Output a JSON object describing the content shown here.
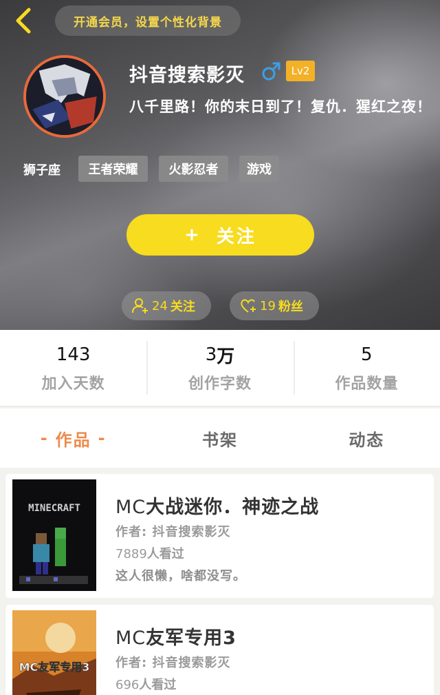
{
  "header": {
    "vip_banner": "开通会员，设置个性化背景",
    "username": "抖音搜索影灭",
    "level": "Lv2",
    "signature": "八千里路！你的末日到了！复仇．猩红之夜！",
    "zodiac": "狮子座",
    "tags": [
      "王者荣耀",
      "火影忍者",
      "游戏"
    ],
    "follow_button": {
      "plus": "+",
      "label": "关注"
    },
    "following": {
      "count": "24",
      "label": "关注"
    },
    "fans": {
      "count": "19",
      "label": "粉丝"
    }
  },
  "stats": [
    {
      "value": "143",
      "label": "加入天数"
    },
    {
      "value": "3",
      "unit": "万",
      "label": "创作字数"
    },
    {
      "value": "5",
      "label": "作品数量"
    }
  ],
  "tabs": {
    "active_dash": "-",
    "items": [
      "作品",
      "书架",
      "动态"
    ]
  },
  "works": [
    {
      "title_prefix": "MC",
      "title_rest": "大战迷你．神迹之战",
      "author": "作者: 抖音搜索影灭",
      "views_num": "7889",
      "views_label": "人看过",
      "desc": "这人很懒，啥都没写。",
      "cover_text": "MINECRAFT"
    },
    {
      "title_prefix": "MC",
      "title_rest": "友军专用3",
      "author": "作者: 抖音搜索影灭",
      "views_num": "696",
      "views_label": "人看过",
      "cover_text": "MC友军专用3"
    }
  ],
  "colors": {
    "accent_yellow": "#f7dc1f",
    "active_tab": "#ef8a4a",
    "level_badge": "#f3b128",
    "gender_blue": "#3aa0e8"
  },
  "icons": {
    "back": "chevron-left-icon",
    "gender": "male-icon",
    "following": "add-user-icon",
    "fans": "heart-plus-icon"
  }
}
